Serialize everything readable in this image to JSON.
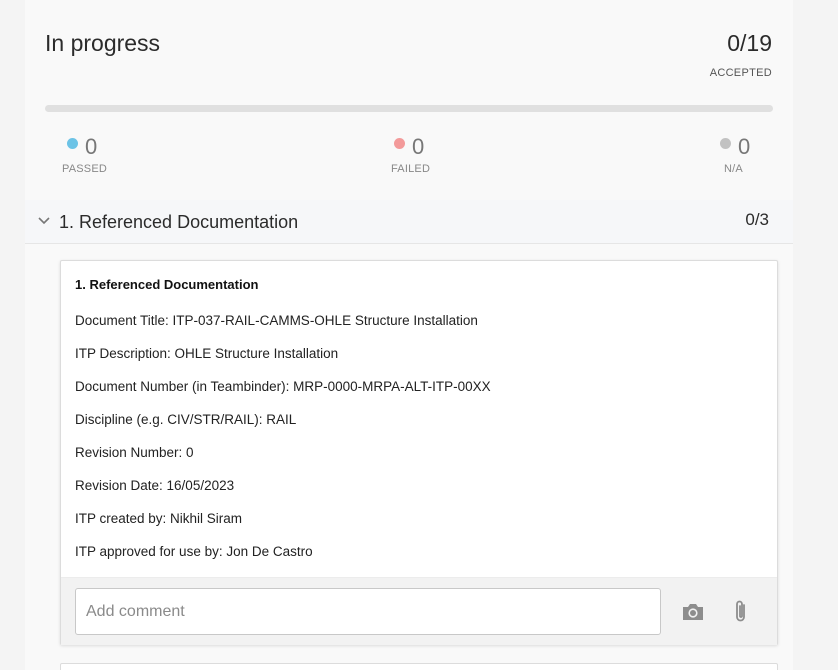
{
  "header": {
    "title": "In progress",
    "count": "0/19",
    "count_label": "ACCEPTED"
  },
  "progress": {
    "fraction": 0
  },
  "stats": {
    "passed": {
      "value": "0",
      "label": "PASSED",
      "color": "#6cc3e6"
    },
    "failed": {
      "value": "0",
      "label": "FAILED",
      "color": "#f39a9a"
    },
    "na": {
      "value": "0",
      "label": "N/A",
      "color": "#c2c2c2"
    }
  },
  "section": {
    "title": "1. Referenced Documentation",
    "count": "0/3",
    "expanded_icon": "chevron-down-icon"
  },
  "card": {
    "heading": "1. Referenced Documentation",
    "lines": [
      "Document Title: ITP-037-RAIL-CAMMS-OHLE Structure Installation",
      "ITP Description: OHLE Structure Installation",
      "Document Number (in Teambinder): MRP-0000-MRPA-ALT-ITP-00XX",
      "Discipline (e.g. CIV/STR/RAIL): RAIL",
      "Revision Number: 0",
      "Revision Date: 16/05/2023",
      "ITP created by: Nikhil Siram",
      "ITP approved for use by: Jon De Castro"
    ],
    "comment": {
      "value": "",
      "placeholder": "Add comment"
    },
    "actions": {
      "camera_icon": "camera-icon",
      "attach_icon": "paperclip-icon"
    }
  }
}
